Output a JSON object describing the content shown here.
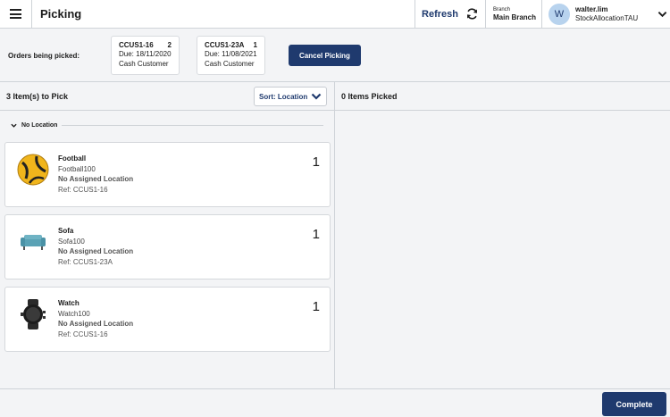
{
  "header": {
    "title": "Picking",
    "refresh_label": "Refresh",
    "branch_caption": "Branch",
    "branch_value": "Main Branch",
    "user_initial": "W",
    "user_name": "walter.lim",
    "user_sub": "StockAllocationTAU"
  },
  "orders": {
    "label": "Orders being picked:",
    "cards": [
      {
        "id": "CCUS1-16",
        "count": "2",
        "due": "Due: 18/11/2020",
        "customer": "Cash Customer"
      },
      {
        "id": "CCUS1-23A",
        "count": "1",
        "due": "Due: 11/08/2021",
        "customer": "Cash Customer"
      }
    ],
    "cancel_label": "Cancel Picking"
  },
  "to_pick": {
    "heading": "3 Item(s) to Pick",
    "sort_label": "Sort: Location",
    "group_label": "No Location",
    "items": [
      {
        "name": "Football",
        "sku": "Football100",
        "location": "No Assigned Location",
        "ref": "Ref: CCUS1-16",
        "qty": "1",
        "icon": "football-image"
      },
      {
        "name": "Sofa",
        "sku": "Sofa100",
        "location": "No Assigned Location",
        "ref": "Ref: CCUS1-23A",
        "qty": "1",
        "icon": "sofa-image"
      },
      {
        "name": "Watch",
        "sku": "Watch100",
        "location": "No Assigned Location",
        "ref": "Ref: CCUS1-16",
        "qty": "1",
        "icon": "watch-image"
      }
    ]
  },
  "picked": {
    "heading": "0 Items Picked"
  },
  "footer": {
    "complete_label": "Complete"
  },
  "colors": {
    "primary": "#1f3a6e",
    "avatar": "#b8d3ee",
    "background": "#f3f4f6"
  }
}
